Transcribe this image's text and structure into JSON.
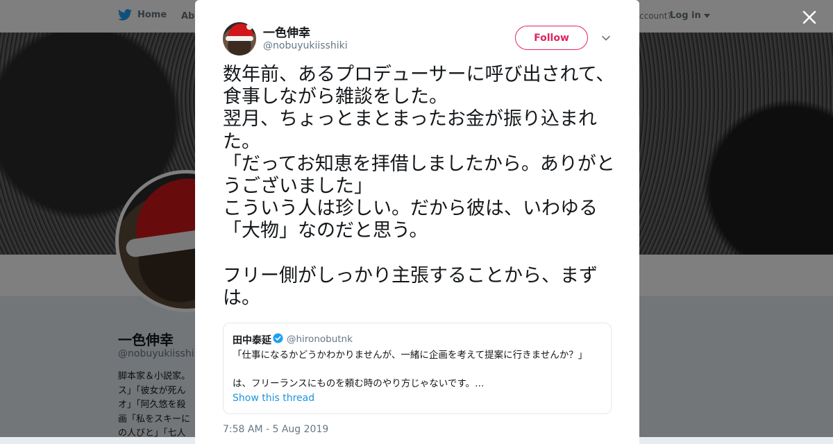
{
  "nav": {
    "home_label": "Home",
    "about_label": "Abo",
    "account_text": "ccount?",
    "login_label": "Log in"
  },
  "profile": {
    "name": "一色伸幸",
    "handle": "@nobuyukiisshiki",
    "bio": "脚本家＆小説家。\nス」「彼女が死ん\nオ」「阿久悠を殺\n画「私をスキーに\nの人びと」「七人"
  },
  "tweet": {
    "author_name": "一色伸幸",
    "author_handle": "@nobuyukiisshiki",
    "follow_label": "Follow",
    "text": "数年前、あるプロデューサーに呼び出されて、食事しながら雑談をした。\n翌月、ちょっとまとまったお金が振り込まれた。\n「だってお知恵を拝借しましたから。ありがとうございました」\nこういう人は珍しい。だから彼は、いわゆる「大物」なのだと思う。\n\nフリー側がしっかり主張することから、まずは。",
    "timestamp": "7:58 AM - 5 Aug 2019",
    "quoted": {
      "name": "田中泰延",
      "handle": "@hironobutnk",
      "text": "「仕事になるかどうかわかりませんが、一緒に企画を考えて提案に行きませんか？」\n\nは、フリーランスにものを頼む時のやり方じゃないです。…",
      "thread_label": "Show this thread"
    }
  },
  "colors": {
    "follow": "#e0245e",
    "link": "#1b95e0",
    "twitter_blue": "#1da1f2",
    "secondary_text": "#657786"
  },
  "icons": [
    "twitter-bird-icon",
    "caret-down-icon",
    "chevron-down-icon",
    "verified-badge-icon",
    "close-icon"
  ]
}
